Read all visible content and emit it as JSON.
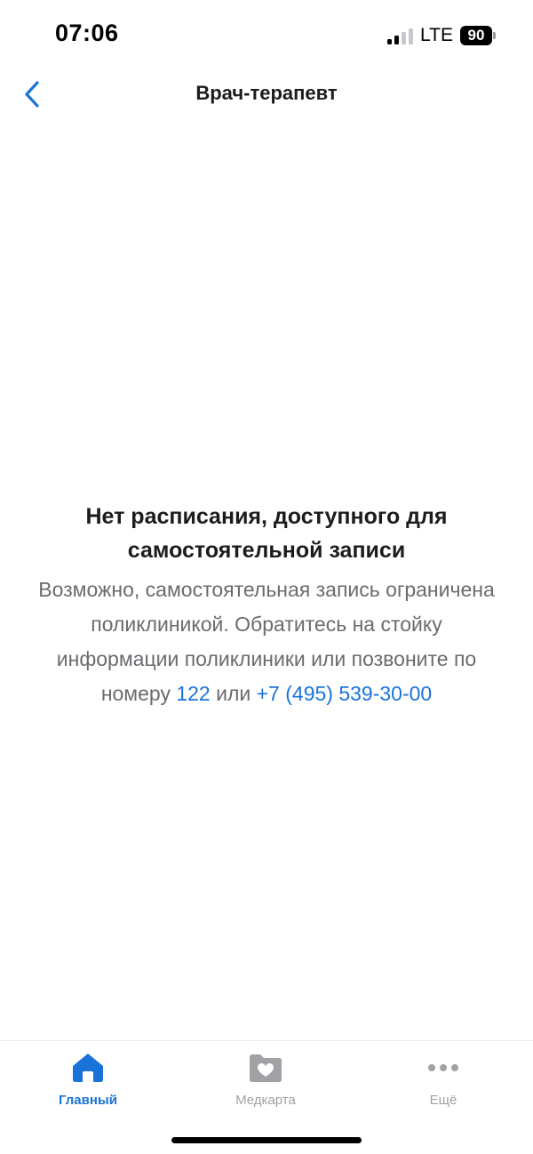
{
  "status_bar": {
    "time": "07:06",
    "network": "LTE",
    "battery": "90"
  },
  "nav": {
    "title": "Врач-терапевт",
    "back_icon": "chevron-left-icon"
  },
  "empty_state": {
    "title": "Нет расписания, доступного для самостоятельной записи",
    "text_before": "Возможно, самостоятельная запись ограничена поликлиникой. Обратитесь на стойку информации поликлиники или позвоните по номеру ",
    "phone_short": "122",
    "text_between": " или ",
    "phone_full": "+7 (495) 539-30-00"
  },
  "tab_bar": {
    "tabs": [
      {
        "label": "Главный",
        "icon": "home-icon",
        "active": true
      },
      {
        "label": "Медкарта",
        "icon": "medcard-folder-icon",
        "active": false
      },
      {
        "label": "Ещё",
        "icon": "more-dots-icon",
        "active": false
      }
    ]
  },
  "colors": {
    "accent": "#1a73d9",
    "inactive": "#a1a1a6",
    "text_primary": "#1c1c1e",
    "text_secondary": "#6b6b70"
  }
}
